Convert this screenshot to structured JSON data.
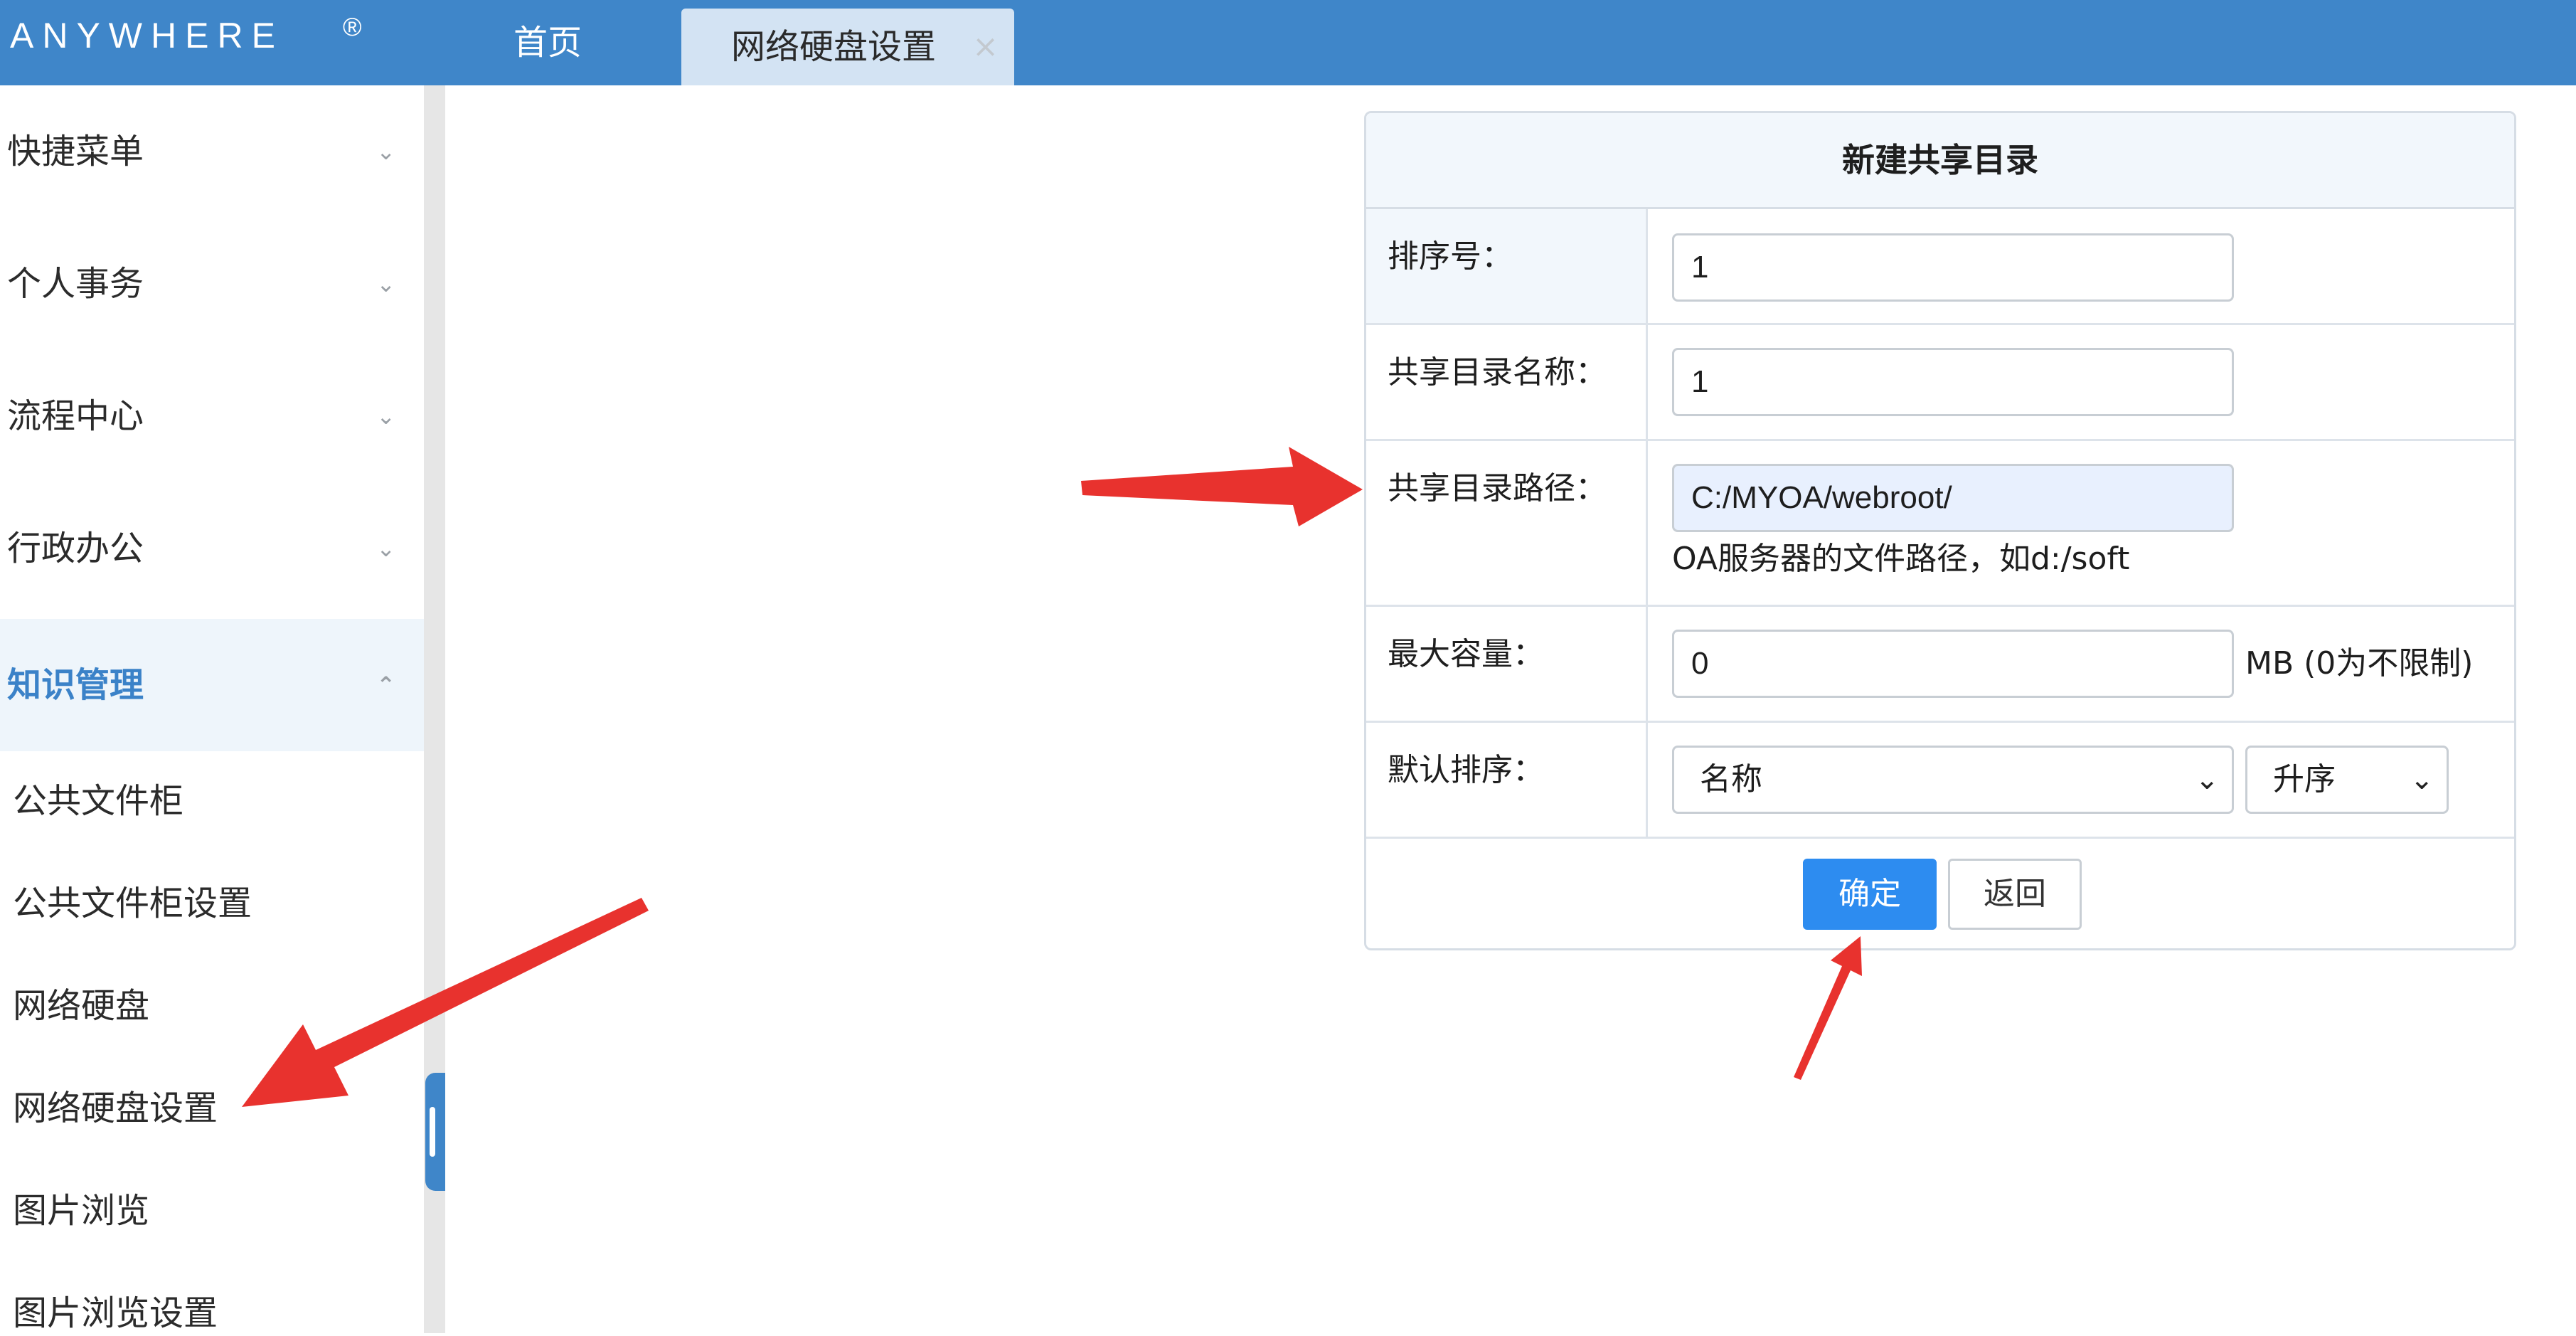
{
  "header": {
    "logo": "ANYWHERE",
    "logo_mark": "®",
    "tabs": [
      {
        "label": "首页"
      },
      {
        "label": "网络硬盘设置",
        "close": "×"
      }
    ]
  },
  "sidebar": {
    "groups": [
      {
        "label": "快捷菜单",
        "chevron": "⌄"
      },
      {
        "label": "个人事务",
        "chevron": "⌄"
      },
      {
        "label": "流程中心",
        "chevron": "⌄"
      },
      {
        "label": "行政办公",
        "chevron": "⌄"
      },
      {
        "label": "知识管理",
        "chevron": "⌃"
      }
    ],
    "sub_items": [
      {
        "label": "公共文件柜"
      },
      {
        "label": "公共文件柜设置"
      },
      {
        "label": "网络硬盘"
      },
      {
        "label": "网络硬盘设置"
      },
      {
        "label": "图片浏览"
      },
      {
        "label": "图片浏览设置"
      }
    ]
  },
  "form": {
    "title": "新建共享目录",
    "sort_no": {
      "label": "排序号：",
      "value": "1"
    },
    "share_name": {
      "label": "共享目录名称：",
      "value": "1"
    },
    "share_path": {
      "label": "共享目录路径：",
      "value": "C:/MYOA/webroot/",
      "hint": "OA服务器的文件路径，如d:/soft"
    },
    "max_capacity": {
      "label": "最大容量：",
      "value": "0",
      "unit": "MB (0为不限制)"
    },
    "default_sort": {
      "label": "默认排序：",
      "field": "名称",
      "order": "升序"
    },
    "buttons": {
      "ok": "确定",
      "back": "返回"
    }
  },
  "colors": {
    "header_bg": "#3f86c9",
    "active_tab_bg": "#d3e3f3",
    "active_menu": "#3b82c8",
    "primary_button": "#2d8cf0",
    "annotation_arrow": "#e8322e"
  }
}
